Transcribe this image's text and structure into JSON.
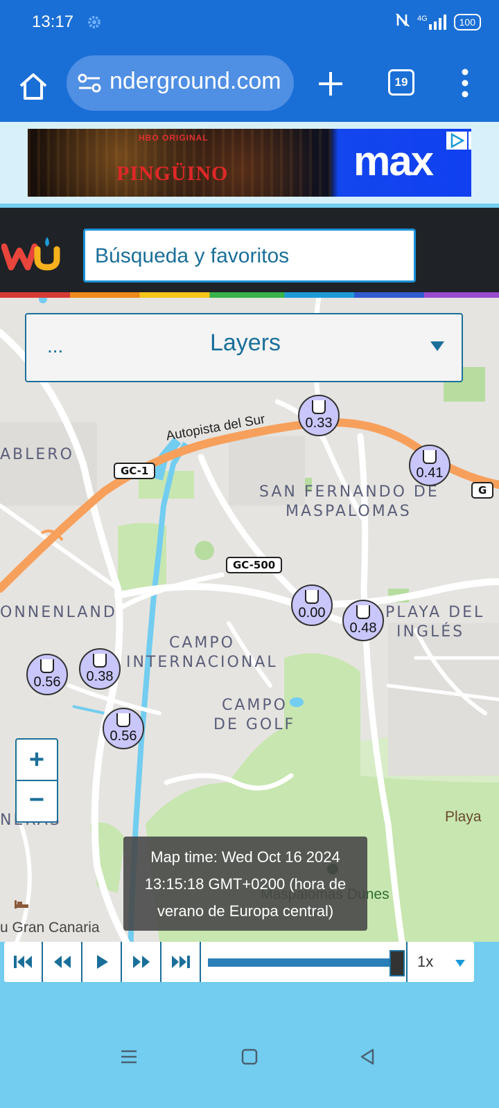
{
  "status_bar": {
    "time": "13:17",
    "network": "4G",
    "battery": "100"
  },
  "browser": {
    "url": "nderground.com",
    "tab_count": "19"
  },
  "ad": {
    "network_text": "HBO ORIGINAL",
    "title": "PINGÜINO",
    "brand": "max"
  },
  "site": {
    "search_placeholder": "Búsqueda y favoritos"
  },
  "map": {
    "layers_dots": "...",
    "layers_label": "Layers",
    "roads": [
      "Autopista del Sur",
      "GC-1",
      "GC-500",
      "G"
    ],
    "places": [
      "ABLERO",
      "SAN FERNANDO DE",
      "MASPALOMAS",
      "ONNENLAND",
      "CAMPO",
      "INTERNACIONAL",
      "PLAYA DEL",
      "INGLÉS",
      "CAMPO",
      "DE GOLF",
      "NERAS",
      "Playa",
      "Maspalomas Dunes",
      "u Gran Canaria"
    ],
    "stations": [
      "0.33",
      "0.41",
      "0.00",
      "0.48",
      "0.56",
      "0.38",
      "0.56"
    ],
    "zoom_in": "+",
    "zoom_out": "−",
    "map_time": "Map time: Wed Oct 16 2024 13:15:18 GMT+0200 (hora de verano de Europa central)"
  },
  "playback": {
    "speed": "1x",
    "progress": 0.97
  },
  "colors": {
    "browser_blue": "#1a6fd6",
    "accent": "#1a6f9a",
    "motorway": "#f7a05c",
    "park": "#c8e6b0",
    "water": "#72cdf0"
  }
}
